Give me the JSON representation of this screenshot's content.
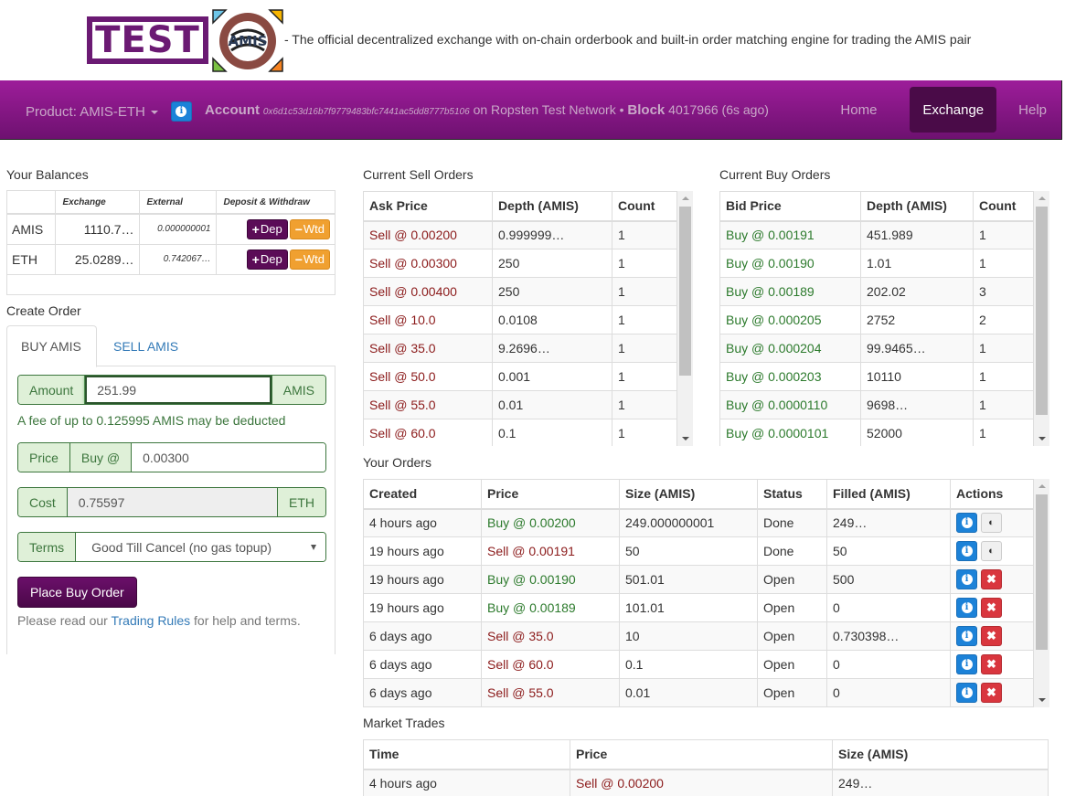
{
  "header": {
    "logo_text": "TEST",
    "logo_badge": "AMIS",
    "tagline": "- The official decentralized exchange with on-chain orderbook and built-in order matching engine for trading the AMIS pair"
  },
  "navbar": {
    "product_label": "Product: AMIS-ETH",
    "account_label": "Account",
    "account_address": "0x6d1c53d16b7f9779483bfc7441ac5dd8777b5106",
    "network_text": "on Ropsten Test Network",
    "bullet": "•",
    "block_label": "Block",
    "block_value": "4017966 (6s ago)",
    "links": [
      {
        "label": "Home",
        "active": false
      },
      {
        "label": "Exchange",
        "active": true
      },
      {
        "label": "Help",
        "active": false
      }
    ]
  },
  "balances": {
    "title": "Your Balances",
    "headers": [
      "",
      "Exchange",
      "External",
      "Deposit & Withdraw"
    ],
    "deposit_label": "Dep",
    "withdraw_label": "Wtd",
    "rows": [
      {
        "token": "AMIS",
        "exchange": "1110.7…",
        "external": "0.000000001"
      },
      {
        "token": "ETH",
        "exchange": "25.0289…",
        "external": "0.742067…"
      }
    ]
  },
  "create_order": {
    "title": "Create Order",
    "tabs": [
      "BUY AMIS",
      "SELL AMIS"
    ],
    "active_tab": "BUY AMIS",
    "amount_label": "Amount",
    "amount_value": "251.99",
    "amount_unit": "AMIS",
    "fee_text": "A fee of up to 0.125995 AMIS may be deducted",
    "price_label": "Price",
    "price_side": "Buy @",
    "price_value": "0.00300",
    "cost_label": "Cost",
    "cost_value": "0.75597",
    "cost_unit": "ETH",
    "terms_label": "Terms",
    "terms_value": "Good Till Cancel (no gas topup)",
    "place_button": "Place Buy Order",
    "help_prefix": "Please read our",
    "help_link": "Trading Rules",
    "help_suffix": "for help and terms."
  },
  "sell_orders": {
    "title": "Current Sell Orders",
    "headers": [
      "Ask Price",
      "Depth (AMIS)",
      "Count"
    ],
    "rows": [
      {
        "price": "Sell @ 0.00200",
        "depth": "0.999999…",
        "count": "1"
      },
      {
        "price": "Sell @ 0.00300",
        "depth": "250",
        "count": "1"
      },
      {
        "price": "Sell @ 0.00400",
        "depth": "250",
        "count": "1"
      },
      {
        "price": "Sell @ 10.0",
        "depth": "0.0108",
        "count": "1"
      },
      {
        "price": "Sell @ 35.0",
        "depth": "9.2696…",
        "count": "1"
      },
      {
        "price": "Sell @ 50.0",
        "depth": "0.001",
        "count": "1"
      },
      {
        "price": "Sell @ 55.0",
        "depth": "0.01",
        "count": "1"
      },
      {
        "price": "Sell @ 60.0",
        "depth": "0.1",
        "count": "1"
      }
    ]
  },
  "buy_orders": {
    "title": "Current Buy Orders",
    "headers": [
      "Bid Price",
      "Depth (AMIS)",
      "Count"
    ],
    "rows": [
      {
        "price": "Buy @ 0.00191",
        "depth": "451.989",
        "count": "1"
      },
      {
        "price": "Buy @ 0.00190",
        "depth": "1.01",
        "count": "1"
      },
      {
        "price": "Buy @ 0.00189",
        "depth": "202.02",
        "count": "3"
      },
      {
        "price": "Buy @ 0.000205",
        "depth": "2752",
        "count": "2"
      },
      {
        "price": "Buy @ 0.000204",
        "depth": "99.9465…",
        "count": "1"
      },
      {
        "price": "Buy @ 0.000203",
        "depth": "10110",
        "count": "1"
      },
      {
        "price": "Buy @ 0.0000110",
        "depth": "9698…",
        "count": "1"
      },
      {
        "price": "Buy @ 0.0000101",
        "depth": "52000",
        "count": "1"
      }
    ]
  },
  "your_orders": {
    "title": "Your Orders",
    "headers": [
      "Created",
      "Price",
      "Size (AMIS)",
      "Status",
      "Filled (AMIS)",
      "Actions"
    ],
    "rows": [
      {
        "created": "4 hours ago",
        "price": "Buy @ 0.00200",
        "side": "buy",
        "size": "249.000000001",
        "status": "Done",
        "filled": "249…",
        "action": "hide"
      },
      {
        "created": "19 hours ago",
        "price": "Sell @ 0.00191",
        "side": "sell",
        "size": "50",
        "status": "Done",
        "filled": "50",
        "action": "hide"
      },
      {
        "created": "19 hours ago",
        "price": "Buy @ 0.00190",
        "side": "buy",
        "size": "501.01",
        "status": "Open",
        "filled": "500",
        "action": "cancel"
      },
      {
        "created": "19 hours ago",
        "price": "Buy @ 0.00189",
        "side": "buy",
        "size": "101.01",
        "status": "Open",
        "filled": "0",
        "action": "cancel"
      },
      {
        "created": "6 days ago",
        "price": "Sell @ 35.0",
        "side": "sell",
        "size": "10",
        "status": "Open",
        "filled": "0.730398…",
        "action": "cancel"
      },
      {
        "created": "6 days ago",
        "price": "Sell @ 60.0",
        "side": "sell",
        "size": "0.1",
        "status": "Open",
        "filled": "0",
        "action": "cancel"
      },
      {
        "created": "6 days ago",
        "price": "Sell @ 55.0",
        "side": "sell",
        "size": "0.01",
        "status": "Open",
        "filled": "0",
        "action": "cancel"
      }
    ]
  },
  "market_trades": {
    "title": "Market Trades",
    "headers": [
      "Time",
      "Price",
      "Size (AMIS)"
    ],
    "rows": [
      {
        "time": "4 hours ago",
        "price": "Sell @ 0.00200",
        "side": "sell",
        "size": "249…"
      }
    ]
  },
  "colors": {
    "brand_purple": "#8b1a8a",
    "sell_red": "#8b1a1a",
    "buy_green": "#2c7a2c",
    "info_blue": "#1c82d8",
    "withdraw_orange": "#f0a030"
  }
}
